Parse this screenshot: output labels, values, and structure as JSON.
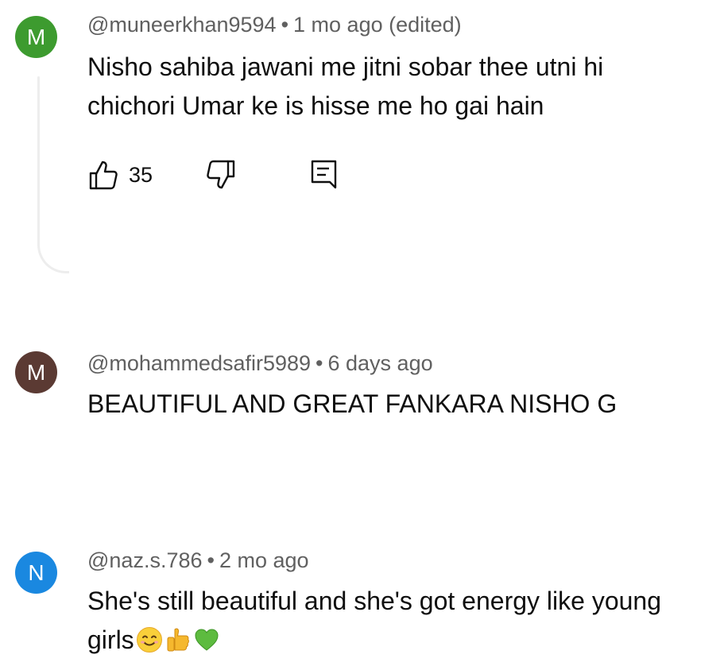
{
  "comments": [
    {
      "avatar_letter": "M",
      "avatar_color": "#3d9b2f",
      "handle": "@muneerkhan9594",
      "separator": "•",
      "time": "1 mo ago (edited)",
      "text_line1": "Nisho sahiba jawani me jitni sobar thee utni hi",
      "text_line2": "chichori Umar ke is hisse me ho gai hain",
      "like_count": "35",
      "icons": [
        "thumbs-up-icon",
        "thumbs-down-icon",
        "reply-icon"
      ]
    },
    {
      "avatar_letter": "M",
      "avatar_color": "#5b3a33",
      "handle": "@mohammedsafir5989",
      "separator": "•",
      "time": "6 days ago",
      "text_line1": "BEAUTIFUL AND GREAT FANKARA NISHO G"
    },
    {
      "avatar_letter": "N",
      "avatar_color": "#1a88e0",
      "handle": "@naz.s.786",
      "separator": "•",
      "time": "2 mo ago",
      "text_line1": "She's still beautiful and she's got energy like young",
      "text_line2": "girls",
      "emojis": [
        "smiling-face-emoji",
        "thumbs-up-emoji",
        "green-heart-emoji"
      ]
    }
  ]
}
